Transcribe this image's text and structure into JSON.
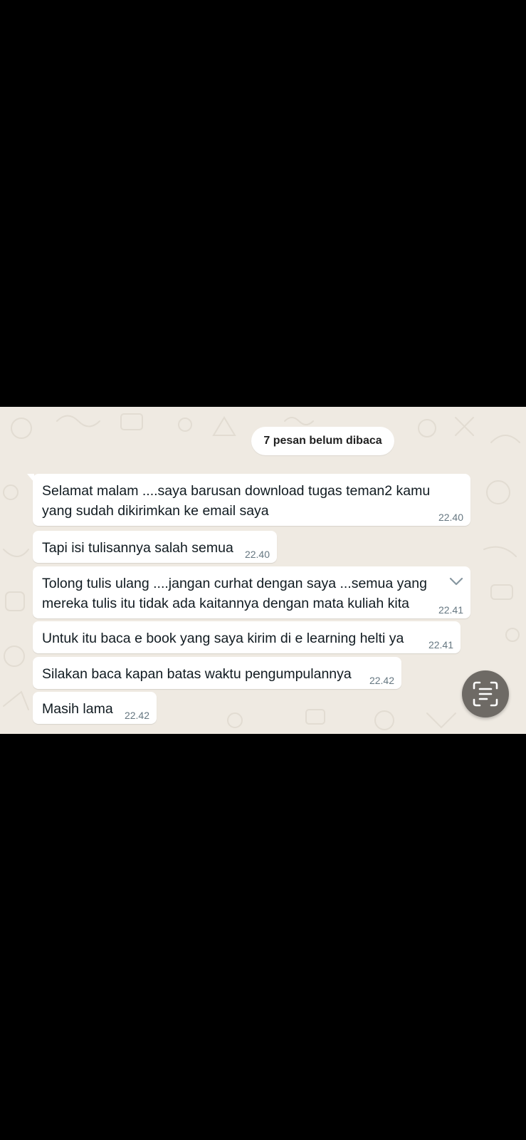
{
  "unread_banner": "7 pesan belum dibaca",
  "messages": [
    {
      "text": "Selamat malam ....saya barusan download tugas teman2 kamu\nyang sudah dikirimkan ke email saya",
      "time": "22.40"
    },
    {
      "text": "Tapi isi tulisannya salah semua",
      "time": "22.40"
    },
    {
      "text": "Tolong tulis ulang ....jangan curhat dengan saya ...semua yang\nmereka tulis itu tidak ada kaitannya dengan mata kuliah kita",
      "time": "22.41"
    },
    {
      "text": "Untuk itu baca e book yang saya kirim di e learning helti ya",
      "time": "22.41"
    },
    {
      "text": "Silakan baca kapan batas waktu pengumpulannya",
      "time": "22.42"
    },
    {
      "text": "Masih lama",
      "time": "22.42"
    }
  ],
  "icons": {
    "message_menu": "chevron-down-icon",
    "scan": "text-scan-icon"
  },
  "colors": {
    "chat_background": "#efeae2",
    "bubble": "#ffffff",
    "timestamp": "#667781",
    "scan_button": "#6e6a65"
  }
}
